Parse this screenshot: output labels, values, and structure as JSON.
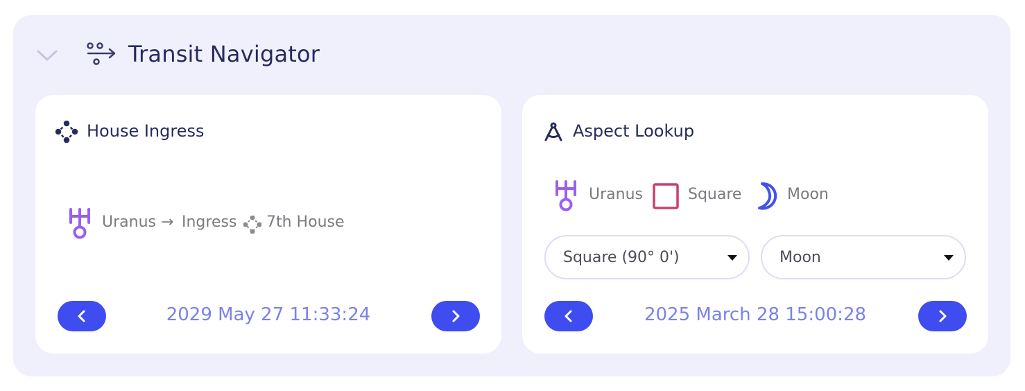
{
  "header": {
    "title": "Transit Navigator",
    "collapse_icon": "chevron-down-icon",
    "title_icon": "transit-arrows-icon"
  },
  "house_ingress": {
    "title": "House Ingress",
    "icon": "house-icon",
    "planet": "Uranus",
    "arrow": "→",
    "action": "Ingress",
    "house": "7th House",
    "date": "2029 May 27 11:33:24",
    "prev_icon": "chevron-left-icon",
    "next_icon": "chevron-right-icon"
  },
  "aspect_lookup": {
    "title": "Aspect Lookup",
    "icon": "compass-icon",
    "planet": "Uranus",
    "aspect": "Square",
    "target": "Moon",
    "aspect_select": {
      "value": "Square (90° 0')"
    },
    "target_select": {
      "value": "Moon"
    },
    "date": "2025 March 28 15:00:28"
  },
  "colors": {
    "accent": "#3f4cf0",
    "uranus": "#9b5ff0",
    "square": "#c8416e",
    "moon": "#4552e8",
    "date_text": "#7b82e8",
    "title_text": "#262b5e",
    "panel_bg": "#f0f0fc"
  }
}
